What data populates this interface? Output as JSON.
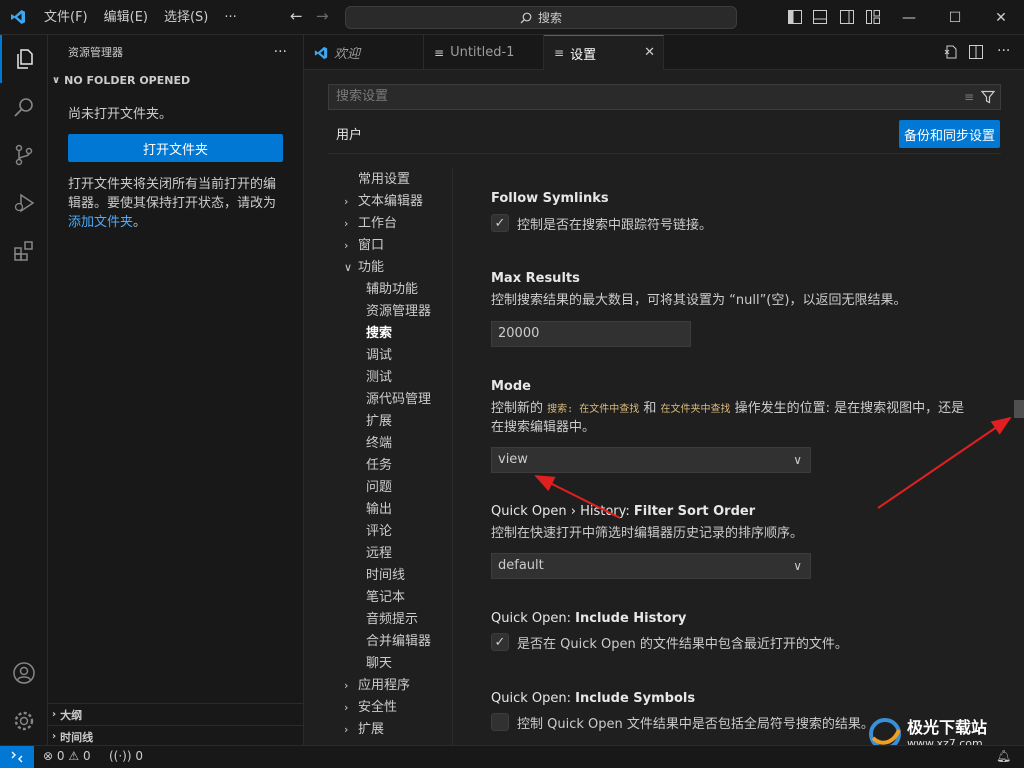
{
  "titlebar": {
    "menus": [
      "文件(F)",
      "编辑(E)",
      "选择(S)"
    ],
    "more": "···",
    "search_placeholder": "搜索"
  },
  "sidebar": {
    "title": "资源管理器",
    "more": "···",
    "section": "NO FOLDER OPENED",
    "no_folder_text": "尚未打开文件夹。",
    "open_button": "打开文件夹",
    "hint_text": "打开文件夹将关闭所有当前打开的编辑器。要使其保持打开状态，请改为",
    "add_folder_link": "添加文件夹",
    "hint_end": "。",
    "outline": "大纲",
    "timeline": "时间线"
  },
  "tabs": [
    {
      "label": "欢迎",
      "icon": "vscode-icon"
    },
    {
      "label": "Untitled-1",
      "icon": "file-icon"
    },
    {
      "label": "设置",
      "icon": "settings-file-icon"
    }
  ],
  "settings": {
    "search_placeholder": "搜索设置",
    "user_tab": "用户",
    "sync_button": "备份和同步设置",
    "toc": [
      {
        "label": "常用设置",
        "chevron": false,
        "level": 0
      },
      {
        "label": "文本编辑器",
        "chevron": true,
        "level": 0
      },
      {
        "label": "工作台",
        "chevron": true,
        "level": 0
      },
      {
        "label": "窗口",
        "chevron": true,
        "level": 0
      },
      {
        "label": "功能",
        "chevron": true,
        "expanded": true,
        "level": 0
      },
      {
        "label": "辅助功能",
        "level": 1
      },
      {
        "label": "资源管理器",
        "level": 1
      },
      {
        "label": "搜索",
        "level": 1,
        "active": true
      },
      {
        "label": "调试",
        "level": 1
      },
      {
        "label": "测试",
        "level": 1
      },
      {
        "label": "源代码管理",
        "level": 1
      },
      {
        "label": "扩展",
        "level": 1
      },
      {
        "label": "终端",
        "level": 1
      },
      {
        "label": "任务",
        "level": 1
      },
      {
        "label": "问题",
        "level": 1
      },
      {
        "label": "输出",
        "level": 1
      },
      {
        "label": "评论",
        "level": 1
      },
      {
        "label": "远程",
        "level": 1
      },
      {
        "label": "时间线",
        "level": 1
      },
      {
        "label": "笔记本",
        "level": 1
      },
      {
        "label": "音频提示",
        "level": 1
      },
      {
        "label": "合并编辑器",
        "level": 1
      },
      {
        "label": "聊天",
        "level": 1
      },
      {
        "label": "应用程序",
        "chevron": true,
        "level": 0
      },
      {
        "label": "安全性",
        "chevron": true,
        "level": 0
      },
      {
        "label": "扩展",
        "chevron": true,
        "level": 0
      }
    ],
    "follow_symlinks": {
      "title": "Follow Symlinks",
      "label": "控制是否在搜索中跟踪符号链接。",
      "checked": true
    },
    "max_results": {
      "title": "Max Results",
      "desc": "控制搜索结果的最大数目，可将其设置为 “null”(空)，以返回无限结果。",
      "value": "20000"
    },
    "mode": {
      "title": "Mode",
      "desc_pre": "控制新的",
      "code1": "搜索: 在文件中查找",
      "desc_mid": "和",
      "code2": "在文件夹中查找",
      "desc_post": "操作发生的位置: 是在搜索视图中，还是",
      "desc_line2": "在搜索编辑器中。",
      "value": "view"
    },
    "quick_open_sort": {
      "title_prefix": "Quick Open › History: ",
      "title": "Filter Sort Order",
      "desc": "控制在快速打开中筛选时编辑器历史记录的排序顺序。",
      "value": "default"
    },
    "include_history": {
      "title_prefix": "Quick Open: ",
      "title": "Include History",
      "label": "是否在 Quick Open 的文件结果中包含最近打开的文件。",
      "checked": true
    },
    "include_symbols": {
      "title_prefix": "Quick Open: ",
      "title": "Include Symbols",
      "label": "控制 Quick Open 文件结果中是否包括全局符号搜索的结果。",
      "checked": false
    }
  },
  "statusbar": {
    "errors": "0",
    "warnings": "0",
    "ports": "0"
  },
  "watermark": {
    "text": "极光下载站",
    "url": "www.xz7.com"
  },
  "colors": {
    "accent": "#0078d4",
    "arrow": "#e02020"
  }
}
